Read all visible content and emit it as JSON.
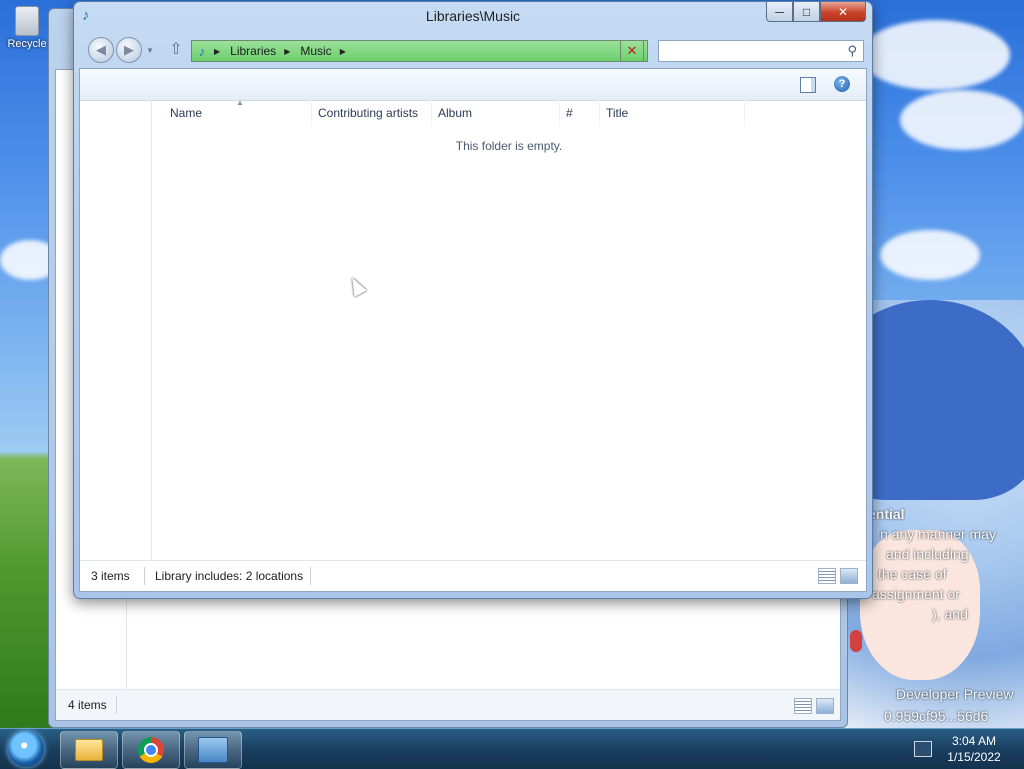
{
  "desktop": {
    "recycle_bin_label": "Recycle",
    "watermark": {
      "line1": "ential",
      "line2": "n any manner may",
      "line3": "and including",
      "line4": "the case of",
      "line5": "assignment or",
      "line6": "), and",
      "line7": "Developer Preview",
      "line8": "0.959cf95...56d6"
    }
  },
  "background_window": {
    "status_count": "4 items"
  },
  "window": {
    "title": "Libraries\\Music",
    "minimize_label": "─",
    "maximize_label": "□",
    "close_label": "✕",
    "address": {
      "crumbs": [
        "Libraries",
        "Music"
      ]
    },
    "search_placeholder": "",
    "columns": [
      "Name",
      "Contributing artists",
      "Album",
      "#",
      "Title"
    ],
    "empty_message": "This folder is empty.",
    "status": {
      "count": "3 items",
      "locations": "Library includes: 2 locations"
    }
  },
  "taskbar": {
    "clock_time": "3:04 AM",
    "clock_date": "1/15/2022",
    "apps": [
      "windows-explorer",
      "google-chrome",
      "computer-management"
    ]
  },
  "colors": {
    "address_bar": "#7fd67f",
    "taskbar": "#1a3f60"
  }
}
